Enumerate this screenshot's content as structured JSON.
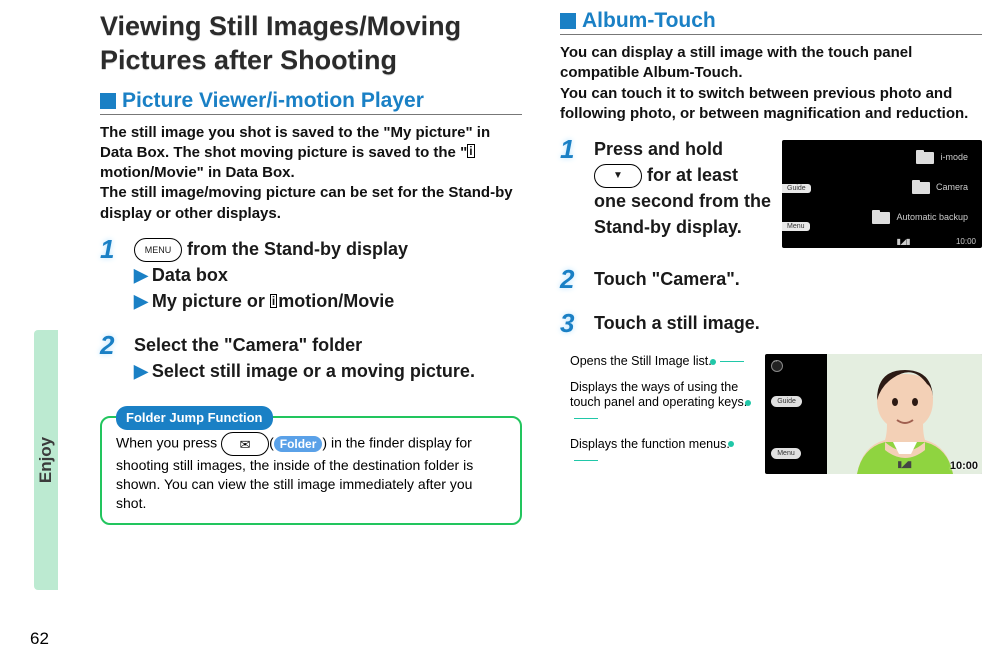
{
  "sideTab": "Enjoy",
  "pageNum": "62",
  "title": "Viewing Still Images/Moving Pictures after Shooting",
  "sectionA": {
    "heading": "Picture Viewer/i-motion Player",
    "lead_a": "The still image you shot is saved to the \"My picture\" in Data Box. The shot moving picture is saved to the \"",
    "lead_b": "motion/Movie\" in Data Box.",
    "lead2": "The still image/moving picture can be set for the Stand-by display or other displays.",
    "step1": {
      "num": "1",
      "menuKey": "MENU",
      "line1_tail": " from the Stand-by display",
      "line2": "Data box",
      "line3_tail": "motion/Movie",
      "line3_head": "My picture or "
    },
    "step2": {
      "num": "2",
      "line1": "Select the \"Camera\" folder",
      "line2": "Select still image or a moving picture."
    },
    "callout": {
      "label": "Folder Jump Function",
      "text_a": "When you press ",
      "mailKey": "✉",
      "pill": "Folder",
      "text_b": " in the finder display for shooting still images, the inside of the destination folder is shown. You can view the still image immediately after you shot."
    }
  },
  "sectionB": {
    "heading": "Album-Touch",
    "lead": "You can display a still image with the touch panel compatible Album-Touch.\nYou can touch it to switch between previous photo and following photo, or between magnification and reduction.",
    "step1": {
      "num": "1",
      "text_a": "Press and hold ",
      "key": "▼",
      "text_b": " for at least one second from the Stand-by display."
    },
    "step2": {
      "num": "2",
      "text": "Touch \"Camera\"."
    },
    "step3": {
      "num": "3",
      "text": "Touch a still image."
    },
    "shot1": {
      "tagGuide": "Guide",
      "tagMenu": "Menu",
      "folder1": "i-mode",
      "folder2": "Camera",
      "folder3": "Automatic backup",
      "statusBars": "▮◢▮",
      "clock": "10:00"
    },
    "annot": {
      "a1": "Opens the Still Image list.",
      "a2": "Displays the ways of using the touch panel and operating keys.",
      "a3": "Displays the function menus."
    },
    "shot2": {
      "btnGuide": "Guide",
      "btnMenu": "Menu",
      "bars": "▮◢▮",
      "clock": "10:00"
    }
  }
}
